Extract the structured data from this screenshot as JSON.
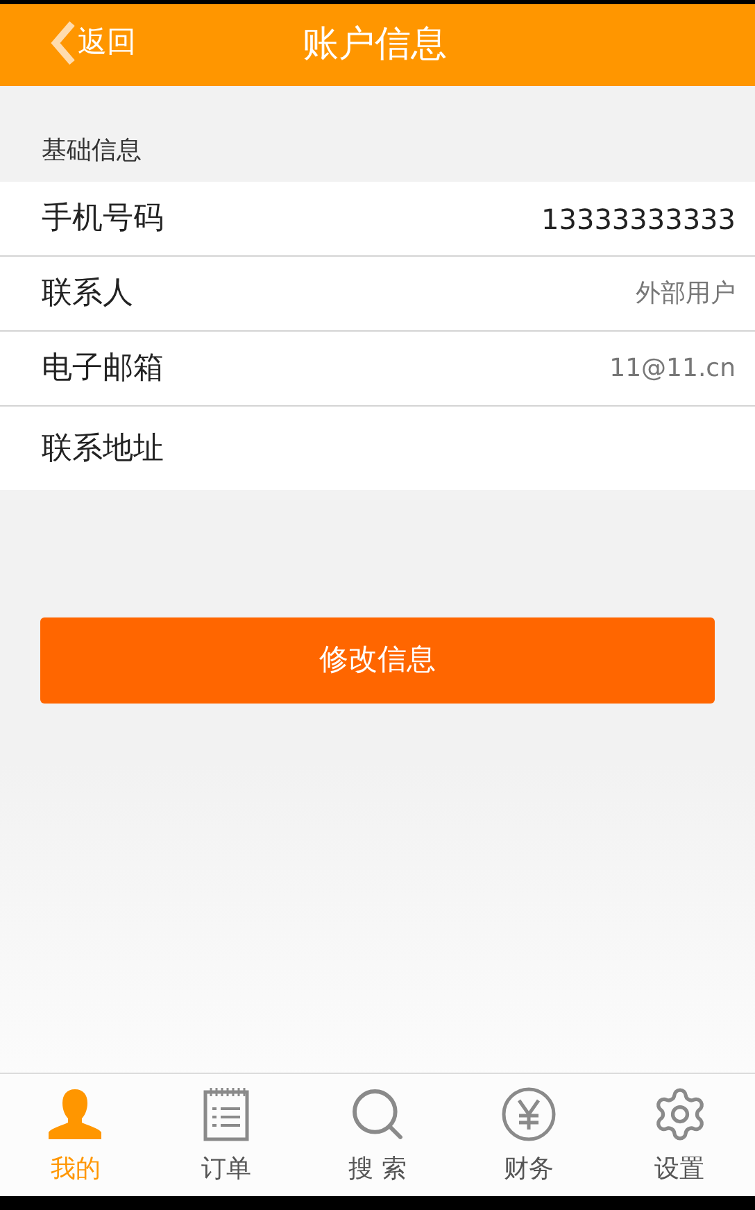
{
  "header": {
    "back": "返回",
    "title": "账户信息"
  },
  "section": {
    "title": "基础信息",
    "rows": [
      {
        "label": "手机号码",
        "value": "13333333333",
        "emphasis": true
      },
      {
        "label": "联系人",
        "value": "外部用户",
        "emphasis": false
      },
      {
        "label": "电子邮箱",
        "value": "11@11.cn",
        "emphasis": false
      },
      {
        "label": "联系地址"
      }
    ]
  },
  "button": "修改信息",
  "tabs": [
    {
      "label": "我的",
      "selected": true
    },
    {
      "label": "订单",
      "selected": false
    },
    {
      "label": "搜 索",
      "selected": false
    },
    {
      "label": "财务",
      "selected": false
    },
    {
      "label": "设置",
      "selected": false
    }
  ]
}
